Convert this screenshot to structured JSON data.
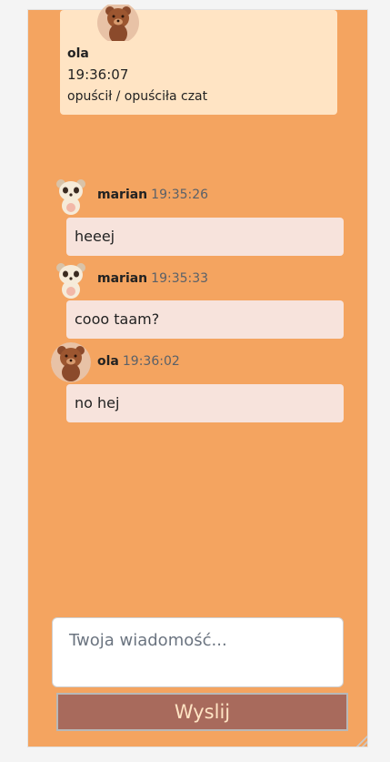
{
  "system_notice": {
    "nick": "ola",
    "time": "19:36:07",
    "text": "opuścił / opuściła czat"
  },
  "messages": [
    {
      "nick": "marian",
      "time": "19:35:26",
      "text": "heeej",
      "avatar": "panda-avatar-icon"
    },
    {
      "nick": "marian",
      "time": "19:35:33",
      "text": "cooo taam?",
      "avatar": "panda-avatar-icon"
    },
    {
      "nick": "ola",
      "time": "19:36:02",
      "text": "no hej",
      "avatar": "bear-avatar-icon"
    }
  ],
  "composer": {
    "placeholder": "Twoja wiadomość...",
    "send_label": "Wyslij"
  },
  "colors": {
    "panel": "#f4a460",
    "notice": "#ffe4c4",
    "bubble": "#f7e3dc",
    "send_button": "#a86a5c"
  }
}
